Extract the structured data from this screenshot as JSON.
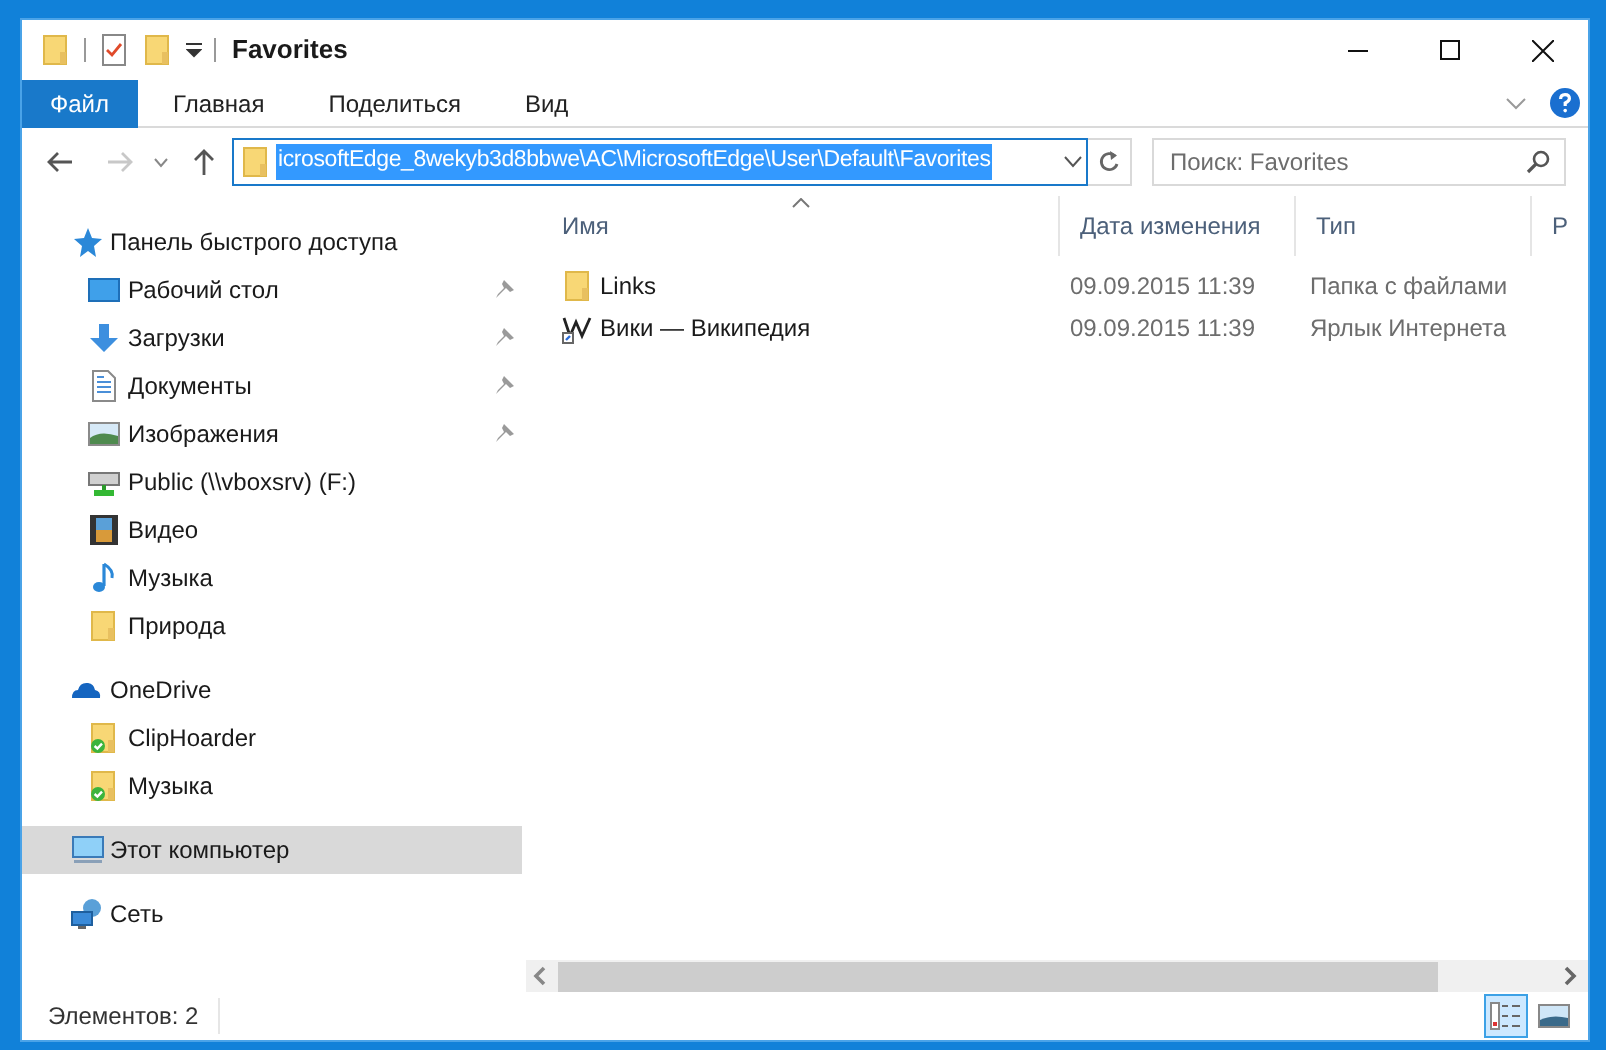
{
  "window": {
    "title": "Favorites"
  },
  "ribbon_tabs": [
    {
      "label": "Файл",
      "selected": true
    },
    {
      "label": "Главная",
      "selected": false
    },
    {
      "label": "Поделиться",
      "selected": false
    },
    {
      "label": "Вид",
      "selected": false
    }
  ],
  "address": {
    "path": "icrosoftEdge_8wekyb3d8bbwe\\AC\\MicrosoftEdge\\User\\Default\\Favorites",
    "selected": true
  },
  "search": {
    "placeholder": "Поиск: Favorites"
  },
  "navigation": [
    {
      "label": "Панель быстрого доступа",
      "kind": "star",
      "selected": false,
      "children": [
        {
          "label": "Рабочий стол",
          "kind": "desktop",
          "selected": false,
          "pinned": true
        },
        {
          "label": "Загрузки",
          "kind": "download",
          "selected": false,
          "pinned": true
        },
        {
          "label": "Документы",
          "kind": "document",
          "selected": false,
          "pinned": true
        },
        {
          "label": "Изображения",
          "kind": "image",
          "selected": false,
          "pinned": true
        },
        {
          "label": "Public (\\\\vboxsrv) (F:)",
          "kind": "drive",
          "selected": false,
          "pinned": false
        },
        {
          "label": "Видео",
          "kind": "video",
          "selected": false,
          "pinned": false
        },
        {
          "label": "Музыка",
          "kind": "music",
          "selected": false,
          "pinned": false
        },
        {
          "label": "Природа",
          "kind": "folder",
          "selected": false,
          "pinned": false
        }
      ]
    },
    {
      "label": "OneDrive",
      "kind": "cloud",
      "selected": false,
      "children": [
        {
          "label": "ClipHoarder",
          "kind": "folder",
          "selected": false,
          "synced": true
        },
        {
          "label": "Музыка",
          "kind": "folder",
          "selected": false,
          "synced": true
        }
      ]
    },
    {
      "label": "Этот компьютер",
      "kind": "computer",
      "selected": true
    },
    {
      "label": "Сеть",
      "kind": "network",
      "selected": false
    }
  ],
  "table": {
    "columns": [
      {
        "label": "Имя",
        "sorted": true
      },
      {
        "label": "Дата изменения",
        "sorted": false
      },
      {
        "label": "Тип",
        "sorted": false
      },
      {
        "label": "Р",
        "sorted": false
      }
    ],
    "rows": [
      {
        "name": "Links",
        "kind": "folder",
        "date": "09.09.2015 11:39",
        "type": "Папка с файлами",
        "selected": false
      },
      {
        "name": "Вики — Википедия",
        "kind": "shortcut",
        "date": "09.09.2015 11:39",
        "type": "Ярлык Интернета",
        "selected": false
      }
    ]
  },
  "status_bar": {
    "count": "Элементов: 2",
    "views": [
      {
        "kind": "details",
        "selected": true
      },
      {
        "kind": "large-icons",
        "selected": false
      }
    ]
  }
}
